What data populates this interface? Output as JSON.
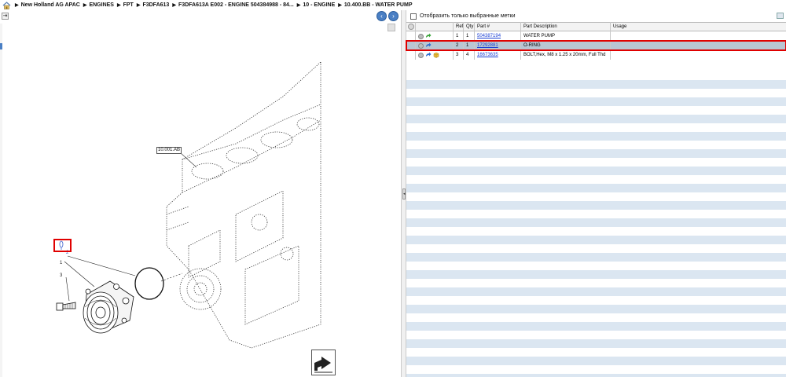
{
  "breadcrumb": {
    "items": [
      "New Holland AG APAC",
      "ENGINES",
      "FPT",
      "F3DFA613",
      "F3DFA613A E002 - ENGINE 504384988 - 84...",
      "10 - ENGINE",
      "10.400.BB - WATER PUMP"
    ]
  },
  "diagram": {
    "section_label": "10.001.AB",
    "callouts": [
      "2",
      "1",
      "3"
    ]
  },
  "filter": {
    "label": "Отобразить только выбранные метки"
  },
  "parts_table": {
    "headers": {
      "ref": "Ref",
      "qty": "Qty",
      "part": "Part #",
      "description": "Part Description",
      "usage": "Usage"
    },
    "rows": [
      {
        "ref": "1",
        "qty": "1",
        "part": "504387194",
        "description": "WATER PUMP",
        "usage": "",
        "icons": [
          "gray-circle-icon",
          "green-arrow-icon"
        ]
      },
      {
        "ref": "2",
        "qty": "1",
        "part": "17292881",
        "description": "O-RING",
        "usage": "",
        "icons": [
          "gray-circle-icon",
          "blue-arrow-icon"
        ]
      },
      {
        "ref": "3",
        "qty": "4",
        "part": "16673635",
        "description": "BOLT,Hex, M8 x 1.25 x 20mm, Full Thd",
        "usage": "",
        "icons": [
          "gray-circle-icon",
          "blue-arrow-icon",
          "package-icon"
        ]
      }
    ]
  },
  "colors": {
    "highlight": "#e00000",
    "link": "#1a3fd4",
    "row_alt": "#dbe6f1",
    "row_selected": "#b9c6d3",
    "nav_button": "#4a7fc4"
  }
}
